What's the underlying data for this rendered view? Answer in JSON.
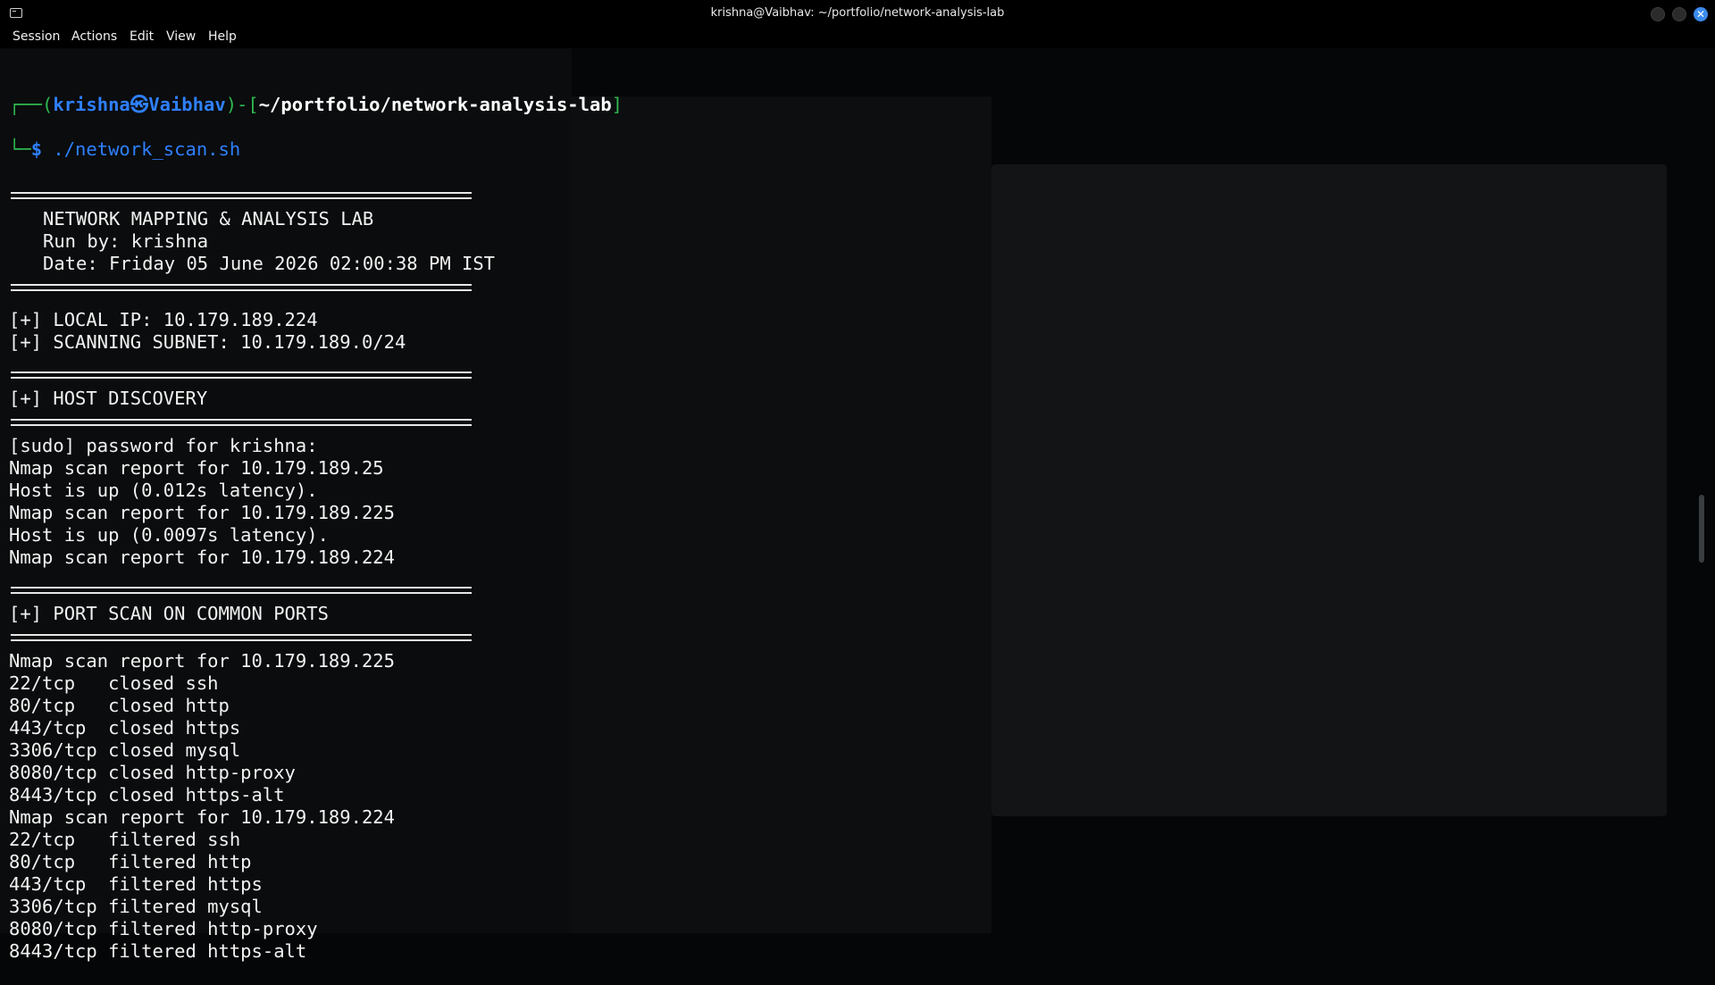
{
  "window": {
    "title": "krishna@Vaibhav: ~/portfolio/network-analysis-lab"
  },
  "menu": [
    "Session",
    "Actions",
    "Edit",
    "View",
    "Help"
  ],
  "prompt": {
    "user": "krishna",
    "separator": "㉿",
    "host": "Vaibhav",
    "path": "~/portfolio/network-analysis-lab",
    "symbol": "$",
    "command": "./network_scan.sh"
  },
  "output": {
    "header": [
      "NETWORK MAPPING & ANALYSIS LAB",
      "Run by: krishna",
      "Date: Friday 05 June 2026 02:00:38 PM IST"
    ],
    "info": [
      "[+] LOCAL IP: 10.179.189.224",
      "[+] SCANNING SUBNET: 10.179.189.0/24"
    ],
    "host_discovery_title": "[+] HOST DISCOVERY",
    "host_discovery": [
      "[sudo] password for krishna:",
      "Nmap scan report for 10.179.189.25",
      "Host is up (0.012s latency).",
      "Nmap scan report for 10.179.189.225",
      "Host is up (0.0097s latency).",
      "Nmap scan report for 10.179.189.224"
    ],
    "port_scan_title": "[+] PORT SCAN ON COMMON PORTS",
    "port_scan": [
      "Nmap scan report for 10.179.189.225",
      "22/tcp   closed ssh",
      "80/tcp   closed http",
      "443/tcp  closed https",
      "3306/tcp closed mysql",
      "8080/tcp closed http-proxy",
      "8443/tcp closed https-alt",
      "Nmap scan report for 10.179.189.224",
      "22/tcp   filtered ssh",
      "80/tcp   filtered http",
      "443/tcp  filtered https",
      "3306/tcp filtered mysql",
      "8080/tcp filtered http-proxy",
      "8443/tcp filtered https-alt"
    ]
  },
  "colors": {
    "prompt_blue": "#2f80ff",
    "prompt_green": "#2fb84f",
    "close_button": "#3b8beb",
    "background": "#050607"
  }
}
